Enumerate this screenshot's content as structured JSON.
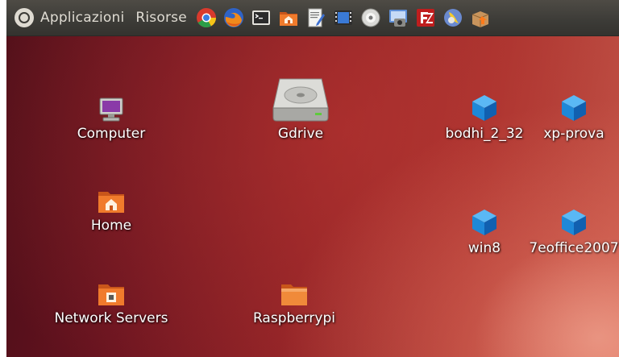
{
  "panel": {
    "menus": [
      "Applicazioni",
      "Risorse"
    ],
    "launchers": [
      "chrome-icon",
      "firefox-icon",
      "terminal-icon",
      "home-folder-icon",
      "text-editor-icon",
      "media-player-icon",
      "disc-burner-icon",
      "screenshot-icon",
      "filezilla-icon",
      "xchat-icon",
      "package-icon"
    ]
  },
  "desktop": {
    "icons": [
      {
        "name": "computer",
        "label": "Computer"
      },
      {
        "name": "gdrive",
        "label": "Gdrive"
      },
      {
        "name": "bodhi_2_32",
        "label": "bodhi_2_32"
      },
      {
        "name": "xp-prova",
        "label": "xp-prova"
      },
      {
        "name": "home",
        "label": "Home"
      },
      {
        "name": "win8",
        "label": "win8"
      },
      {
        "name": "7eoffice2007",
        "label": "7eoffice2007"
      },
      {
        "name": "network-servers",
        "label": "Network Servers"
      },
      {
        "name": "raspberrypi",
        "label": "Raspberrypi"
      }
    ]
  },
  "colors": {
    "panel": "#3c3b37",
    "panel_text": "#dfdbd2",
    "desktop_dark": "#4a0d18",
    "desktop_light": "#c45a4c",
    "folder_orange": "#e8782a",
    "vbox_blue": "#1e88d8"
  }
}
